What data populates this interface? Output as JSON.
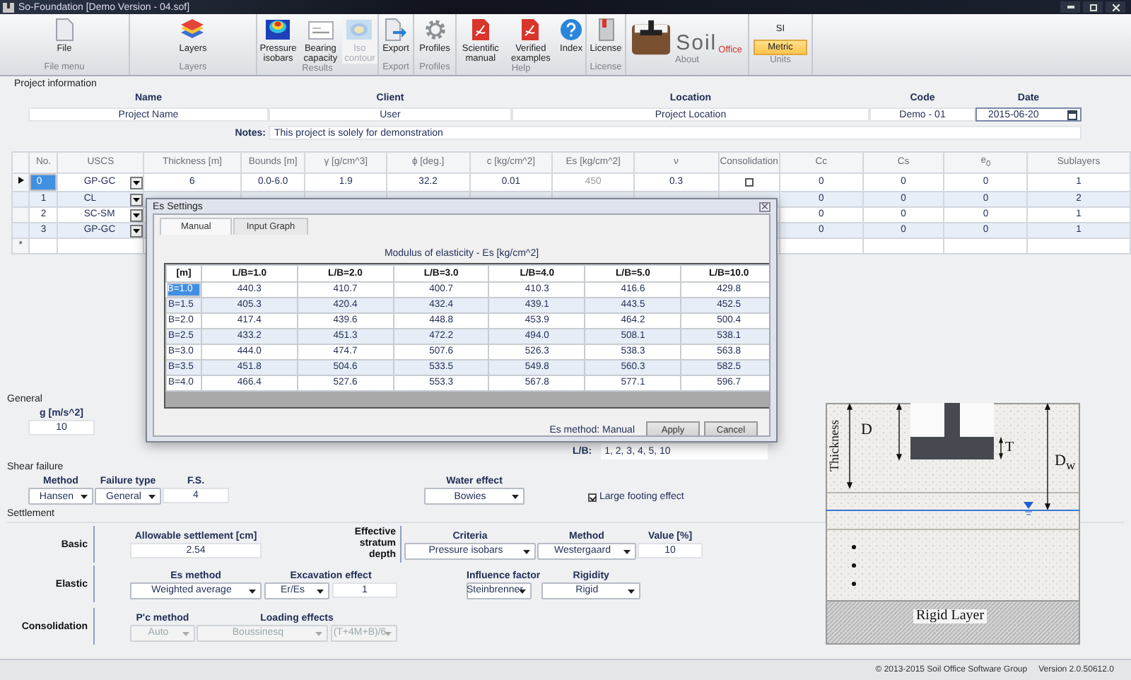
{
  "window": {
    "title": "So-Foundation [Demo Version - 04.sof]"
  },
  "ribbon": [
    {
      "label": "File menu",
      "kind": "buttons",
      "items": [
        {
          "label": "File",
          "disabled": false
        }
      ]
    },
    {
      "label": "Layers",
      "kind": "buttons",
      "items": [
        {
          "label": "Layers",
          "disabled": false
        }
      ]
    },
    {
      "label": "Results",
      "kind": "buttons",
      "items": [
        {
          "label": "Pressure isobars",
          "disabled": false
        },
        {
          "label": "Bearing capacity",
          "disabled": false
        },
        {
          "label": "Iso contour",
          "disabled": true
        }
      ]
    },
    {
      "label": "Export",
      "kind": "buttons",
      "items": [
        {
          "label": "Export",
          "disabled": false
        }
      ]
    },
    {
      "label": "Profiles",
      "kind": "buttons",
      "items": [
        {
          "label": "Profiles",
          "disabled": false
        }
      ]
    },
    {
      "label": "Help",
      "kind": "buttons",
      "items": [
        {
          "label": "Scientific manual",
          "disabled": false
        },
        {
          "label": "Verified examples",
          "disabled": false
        },
        {
          "label": "Index",
          "disabled": false
        }
      ]
    },
    {
      "label": "License",
      "kind": "buttons",
      "items": [
        {
          "label": "License",
          "disabled": false
        }
      ]
    },
    {
      "label": "About",
      "kind": "logo",
      "wordmark": "Soil",
      "suffix": "Office"
    },
    {
      "label": "Units",
      "kind": "units",
      "options": [
        {
          "label": "SI",
          "selected": false
        },
        {
          "label": "Metric",
          "selected": true
        }
      ]
    }
  ],
  "project": {
    "title": "Project information",
    "fields": [
      {
        "label": "Name",
        "value": "Project Name"
      },
      {
        "label": "Client",
        "value": "User"
      },
      {
        "label": "Location",
        "value": "Project Location"
      },
      {
        "label": "Code",
        "value": "Demo - 01"
      },
      {
        "label": "Date",
        "value": "2015-06-20"
      }
    ],
    "notes": {
      "label": "Notes:",
      "value": "This project is solely for demonstration"
    }
  },
  "layers": {
    "columns": [
      "No.",
      "USCS",
      "Thickness [m]",
      "Bounds [m]",
      "γ [g/cm^3]",
      "ϕ [deg.]",
      "c [kg/cm^2]",
      "Es [kg/cm^2]",
      "ν",
      "Consolidation",
      "Cc",
      "Cs",
      "e$_{0}$",
      "Sublayers"
    ],
    "rows": [
      {
        "current": true,
        "selected": true,
        "no": "0",
        "uscs": "GP-GC",
        "thickness": "6",
        "bounds": "0.0-6.0",
        "gamma": "1.9",
        "phi": "32.2",
        "c": "0.01",
        "es": "450",
        "nu": "0.3",
        "consolidation": false,
        "cc": "0",
        "cs": "0",
        "e0": "0",
        "sublayers": "1"
      },
      {
        "current": false,
        "selected": false,
        "no": "1",
        "uscs": "CL",
        "cc": "0",
        "cs": "0",
        "e0": "0",
        "sublayers": "2"
      },
      {
        "current": false,
        "selected": false,
        "no": "2",
        "uscs": "SC-SM",
        "cc": "0",
        "cs": "0",
        "e0": "0",
        "sublayers": "1"
      },
      {
        "current": false,
        "selected": false,
        "no": "3",
        "uscs": "GP-GC",
        "cc": "0",
        "cs": "0",
        "e0": "0",
        "sublayers": "1"
      }
    ],
    "new_row_marker": "*"
  },
  "dialog": {
    "title": "Es Settings",
    "tabs": [
      {
        "label": "Manual",
        "selected": true
      },
      {
        "label": "Input Graph",
        "selected": false
      }
    ],
    "caption": "Modulus of elasticity - Es [kg/cm^2]",
    "corner": "[m]",
    "columns": [
      "L/B=1.0",
      "L/B=2.0",
      "L/B=3.0",
      "L/B=4.0",
      "L/B=5.0",
      "L/B=10.0"
    ],
    "rows": [
      {
        "label": "B=1.0",
        "selected": true,
        "values": [
          "440.3",
          "410.7",
          "400.7",
          "410.3",
          "416.6",
          "429.8"
        ]
      },
      {
        "label": "B=1.5",
        "selected": false,
        "values": [
          "405.3",
          "420.4",
          "432.4",
          "439.1",
          "443.5",
          "452.5"
        ]
      },
      {
        "label": "B=2.0",
        "selected": false,
        "values": [
          "417.4",
          "439.6",
          "448.8",
          "453.9",
          "464.2",
          "500.4"
        ]
      },
      {
        "label": "B=2.5",
        "selected": false,
        "values": [
          "433.2",
          "451.3",
          "472.2",
          "494.0",
          "508.1",
          "538.1"
        ]
      },
      {
        "label": "B=3.0",
        "selected": false,
        "values": [
          "444.0",
          "474.7",
          "507.6",
          "526.3",
          "538.3",
          "563.8"
        ]
      },
      {
        "label": "B=3.5",
        "selected": false,
        "values": [
          "451.8",
          "504.6",
          "533.5",
          "549.8",
          "560.3",
          "582.5"
        ]
      },
      {
        "label": "B=4.0",
        "selected": false,
        "values": [
          "466.4",
          "527.6",
          "553.3",
          "567.8",
          "577.1",
          "596.7"
        ]
      }
    ],
    "method_label": "Es method: Manual",
    "buttons": [
      "Apply",
      "Cancel"
    ]
  },
  "general": {
    "title": "General",
    "g": {
      "label": "g [m/s^2]",
      "controls": [
        {
          "kind": "input",
          "value": "10",
          "disabled": false
        }
      ]
    }
  },
  "lb": {
    "label": "L/B:",
    "value": "1, 2, 3, 4, 5, 10"
  },
  "shear_failure": {
    "title": "Shear failure",
    "groups": [
      {
        "label": "Method",
        "controls": [
          {
            "kind": "select",
            "value": "Hansen",
            "disabled": false
          }
        ]
      },
      {
        "label": "Failure type",
        "controls": [
          {
            "kind": "select",
            "value": "General",
            "disabled": false
          }
        ]
      },
      {
        "label": "F.S.",
        "controls": [
          {
            "kind": "input",
            "value": "4",
            "disabled": false
          }
        ]
      },
      {
        "label": "Water effect",
        "controls": [
          {
            "kind": "select",
            "value": "Bowies",
            "disabled": false
          }
        ]
      }
    ],
    "large_footing": {
      "label": "Large footing effect",
      "checked": true
    }
  },
  "settlement": {
    "title": "Settlement",
    "basic": {
      "label": "Basic",
      "groups": [
        {
          "label": "Allowable settlement [cm]",
          "controls": [
            {
              "kind": "input",
              "value": "2.54",
              "disabled": false
            }
          ]
        }
      ]
    },
    "effective": {
      "label": "Effective stratum depth",
      "groups": [
        {
          "label": "Criteria",
          "controls": [
            {
              "kind": "select",
              "value": "Pressure isobars",
              "disabled": false
            }
          ]
        },
        {
          "label": "Method",
          "controls": [
            {
              "kind": "select",
              "value": "Westergaard",
              "disabled": false
            }
          ]
        },
        {
          "label": "Value [%]",
          "controls": [
            {
              "kind": "input",
              "value": "10",
              "disabled": false
            }
          ]
        }
      ]
    },
    "elastic": {
      "label": "Elastic",
      "groups": [
        {
          "label": "Es method",
          "controls": [
            {
              "kind": "select",
              "value": "Weighted average",
              "disabled": false
            }
          ]
        },
        {
          "label": "Excavation effect",
          "controls": [
            {
              "kind": "select",
              "value": "Er/Es",
              "disabled": false
            },
            {
              "kind": "input",
              "value": "1",
              "disabled": false
            }
          ]
        },
        {
          "label": "Influence factor",
          "controls": [
            {
              "kind": "select",
              "value": "Steinbrenner",
              "disabled": false
            }
          ]
        },
        {
          "label": "Rigidity",
          "controls": [
            {
              "kind": "select",
              "value": "Rigid",
              "disabled": false
            }
          ]
        }
      ]
    },
    "consolidation": {
      "label": "Consolidation",
      "groups": [
        {
          "label": "P'c method",
          "controls": [
            {
              "kind": "select",
              "value": "Auto",
              "disabled": true
            }
          ]
        },
        {
          "label": "Loading effects",
          "controls": [
            {
              "kind": "select",
              "value": "Boussinesq",
              "disabled": true
            },
            {
              "kind": "select",
              "value": "(T+4M+B)/6",
              "disabled": true
            }
          ]
        }
      ]
    }
  },
  "drawing": {
    "thickness": "Thickness",
    "d": "D",
    "t": "T",
    "dw": "D$_{w}$",
    "rigid_layer": "Rigid Layer"
  },
  "status_bar": {
    "copyright": "© 2013-2015 Soil Office Software Group",
    "version": "Version 2.0.50612.0"
  }
}
